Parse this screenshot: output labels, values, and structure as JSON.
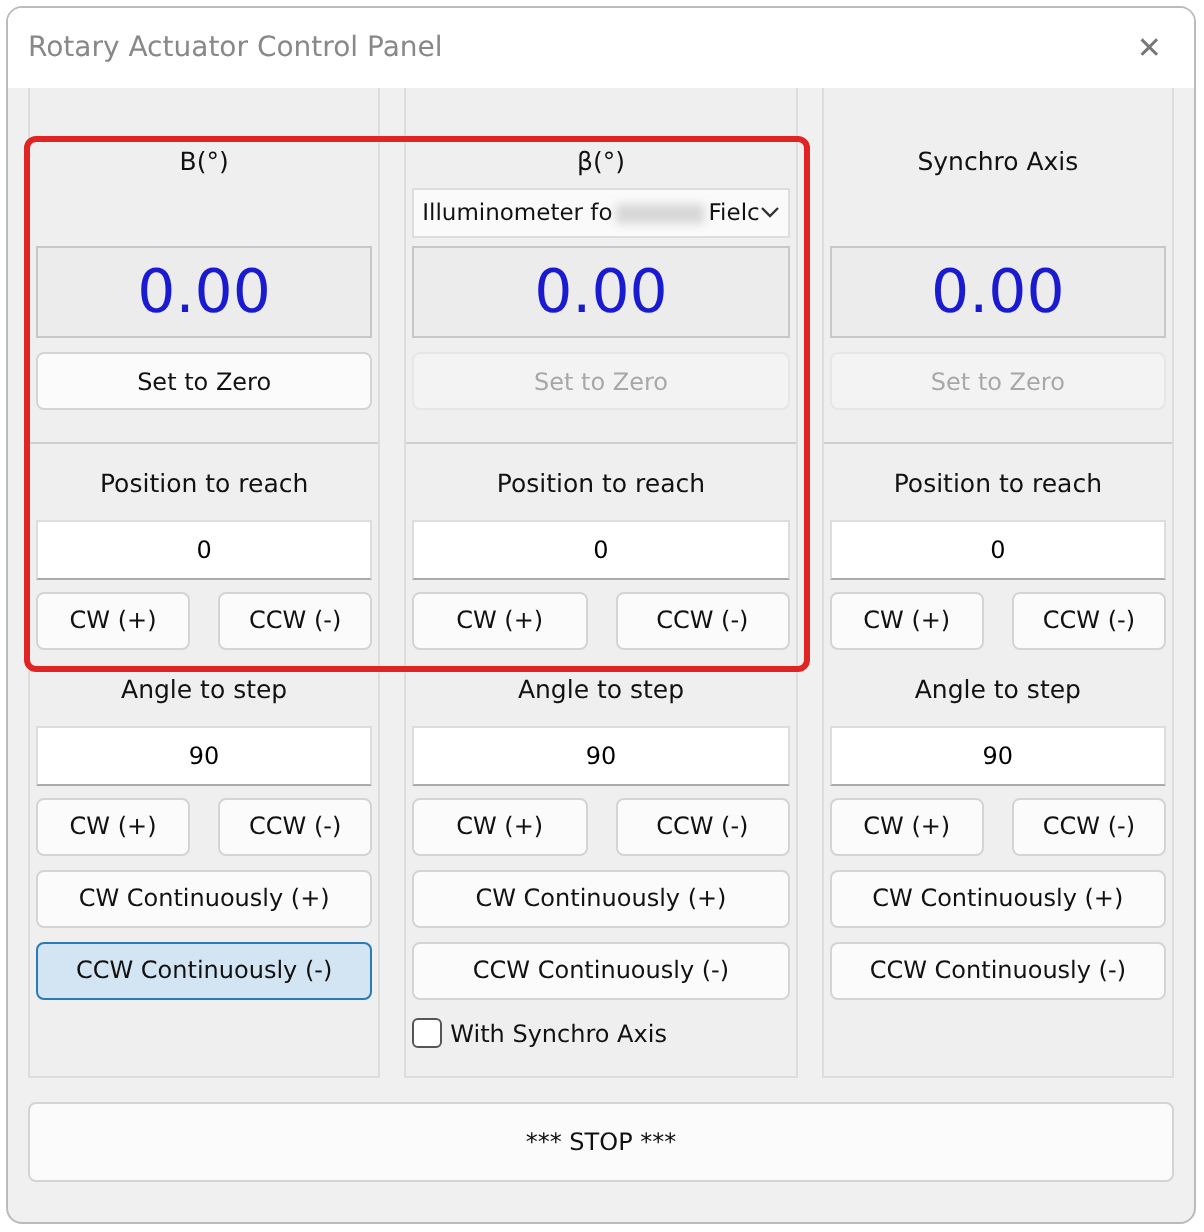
{
  "window": {
    "title": "Rotary Actuator Control Panel",
    "close": "✕"
  },
  "axes": [
    {
      "header": "B(°)",
      "value": "0.00",
      "set_zero": {
        "label": "Set to Zero",
        "disabled": false
      },
      "position_label": "Position to reach",
      "position_value": "0",
      "position_buttons": [
        "CW  (+)",
        "CCW (-)"
      ],
      "angle_label": "Angle to step",
      "angle_value": "90",
      "angle_buttons": [
        "CW  (+)",
        "CCW (-)"
      ],
      "cw_continuous": {
        "label": "CW Continuously (+)",
        "selected": false
      },
      "ccw_continuous": {
        "label": "CCW Continuously (-)",
        "selected": true
      }
    },
    {
      "header": "β(°)",
      "dropdown": {
        "value_start": "Illuminometer fo",
        "value_end": "Fielc",
        "blurred": true
      },
      "value": "0.00",
      "set_zero": {
        "label": "Set to Zero",
        "disabled": true
      },
      "position_label": "Position to reach",
      "position_value": "0",
      "position_buttons": [
        "CW  (+)",
        "CCW (-)"
      ],
      "angle_label": "Angle to step",
      "angle_value": "90",
      "angle_buttons": [
        "CW  (+)",
        "CCW (-)"
      ],
      "cw_continuous": {
        "label": "CW Continuously (+)",
        "selected": false
      },
      "ccw_continuous": {
        "label": "CCW Continuously (-)",
        "selected": false
      },
      "checkbox": {
        "label": "With Synchro Axis",
        "checked": false
      }
    },
    {
      "header": "Synchro Axis",
      "value": "0.00",
      "set_zero": {
        "label": "Set to Zero",
        "disabled": true
      },
      "position_label": "Position to reach",
      "position_value": "0",
      "position_buttons": [
        "CW  (+)",
        "CCW (-)"
      ],
      "angle_label": "Angle to step",
      "angle_value": "90",
      "angle_buttons": [
        "CW  (+)",
        "CCW (-)"
      ],
      "cw_continuous": {
        "label": "CW Continuously (+)",
        "selected": false
      },
      "ccw_continuous": {
        "label": "CCW Continuously (-)",
        "selected": false
      }
    }
  ],
  "stop_button": "*** STOP ***",
  "highlight_frame": {
    "shown": true,
    "color": "#e02424"
  }
}
